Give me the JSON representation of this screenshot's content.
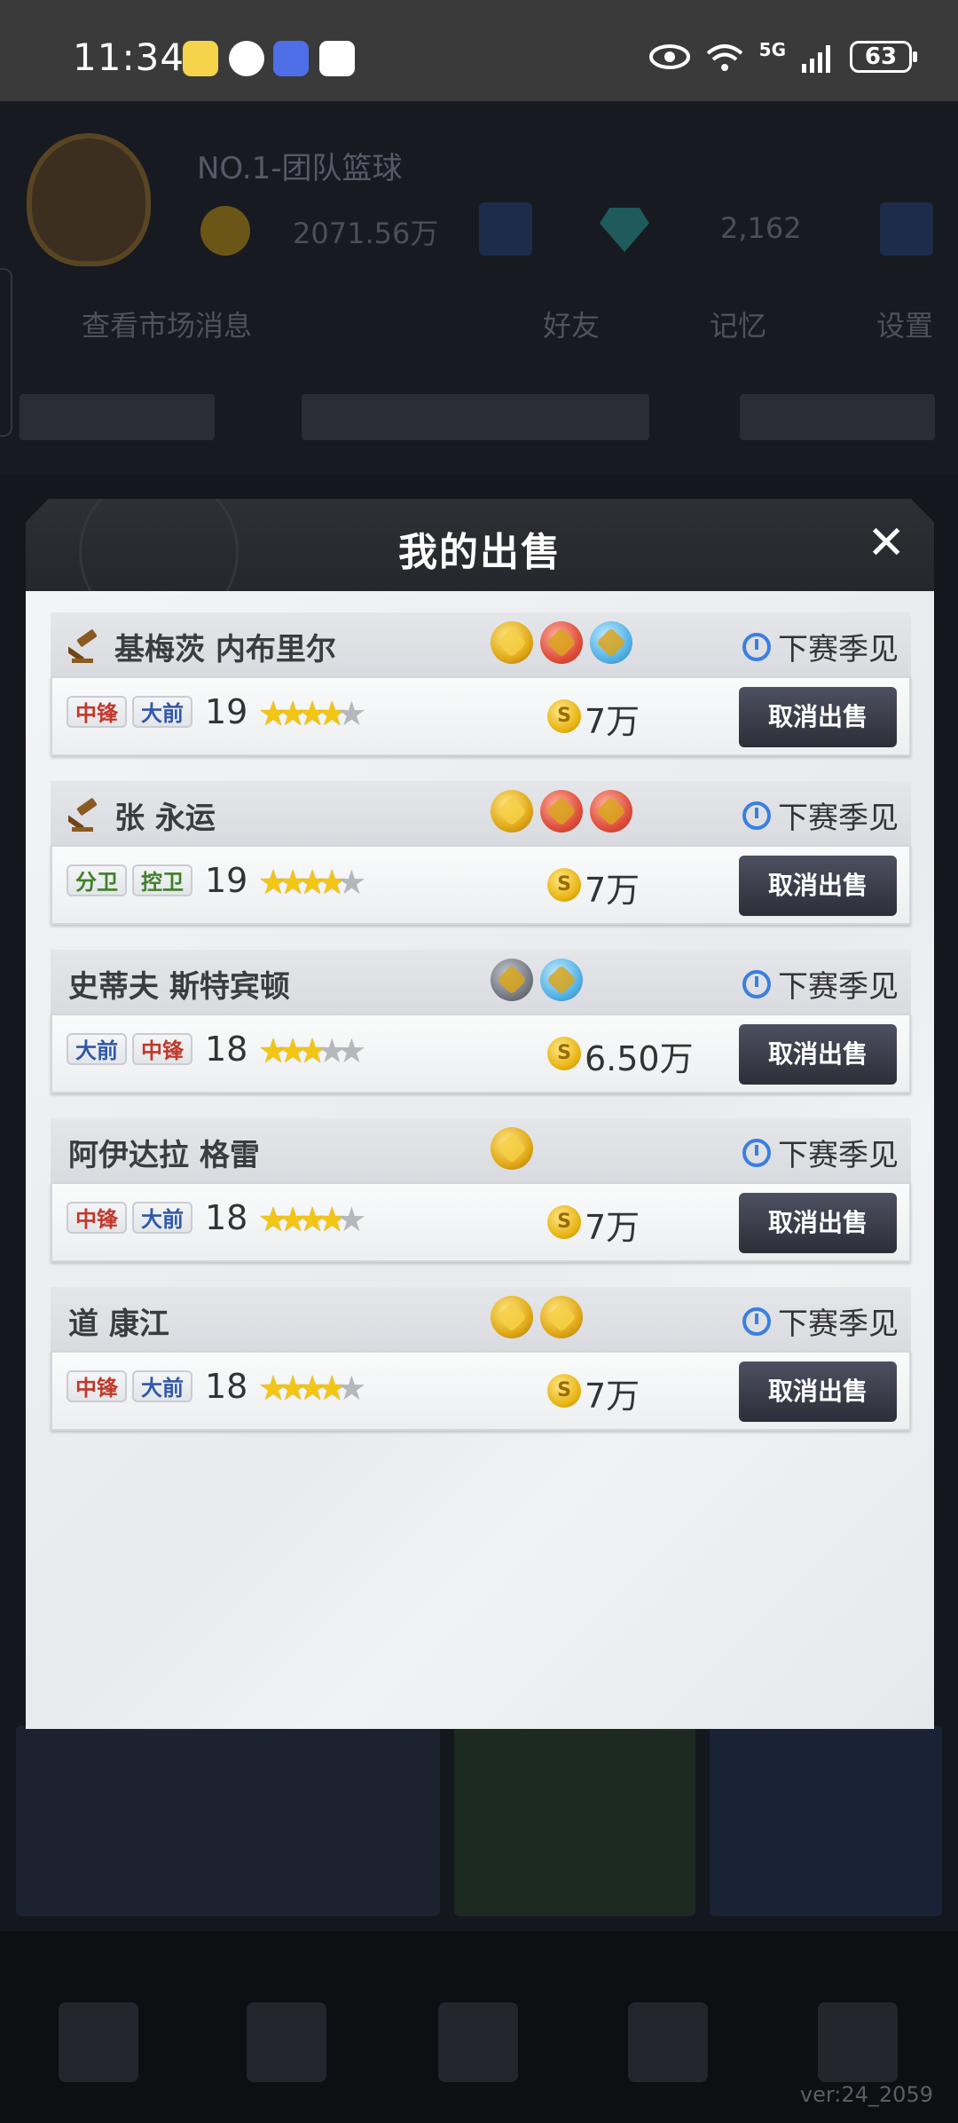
{
  "status_bar": {
    "time": "11:34",
    "battery": "63",
    "network": "5G",
    "icons": [
      "bunny-app-icon",
      "location-icon",
      "message-app-icon",
      "shield-app-icon",
      "eye-icon",
      "wifi-icon",
      "signal-icon",
      "battery-icon"
    ]
  },
  "background": {
    "team_title": "NO.1-团队篮球",
    "coins": "2071.56万",
    "gems": "2,162",
    "links": [
      "查看市场消息",
      "好友",
      "记忆",
      "设置"
    ],
    "version": "ver:24_2059"
  },
  "dialog": {
    "title": "我的出售",
    "close_label": "✕",
    "cancel_label": "取消出售",
    "timer_label": "下赛季见"
  },
  "listings": [
    {
      "name": "基梅茨 内布里尔",
      "auction": true,
      "badges": [
        "gold",
        "red",
        "blue"
      ],
      "positions": [
        {
          "label": "中锋",
          "color": "red"
        },
        {
          "label": "大前",
          "color": "blue"
        }
      ],
      "age": "19",
      "stars": 4,
      "price": "7万"
    },
    {
      "name": "张 永运",
      "auction": true,
      "badges": [
        "gold",
        "red",
        "red"
      ],
      "positions": [
        {
          "label": "分卫",
          "color": "green"
        },
        {
          "label": "控卫",
          "color": "green"
        }
      ],
      "age": "19",
      "stars": 4,
      "price": "7万"
    },
    {
      "name": "史蒂夫 斯特宾顿",
      "auction": false,
      "badges": [
        "gray",
        "blue"
      ],
      "positions": [
        {
          "label": "大前",
          "color": "blue"
        },
        {
          "label": "中锋",
          "color": "red"
        }
      ],
      "age": "18",
      "stars": 3,
      "price": "6.50万"
    },
    {
      "name": "阿伊达拉 格雷",
      "auction": false,
      "badges": [
        "gold"
      ],
      "positions": [
        {
          "label": "中锋",
          "color": "red"
        },
        {
          "label": "大前",
          "color": "blue"
        }
      ],
      "age": "18",
      "stars": 4,
      "price": "7万"
    },
    {
      "name": "道 康江",
      "auction": false,
      "badges": [
        "gold",
        "gold"
      ],
      "positions": [
        {
          "label": "中锋",
          "color": "red"
        },
        {
          "label": "大前",
          "color": "blue"
        }
      ],
      "age": "18",
      "stars": 4,
      "price": "7万"
    }
  ],
  "colors": {
    "accent": "#3b7fe0",
    "button": "#3a3c48",
    "gold": "#f3c515"
  }
}
